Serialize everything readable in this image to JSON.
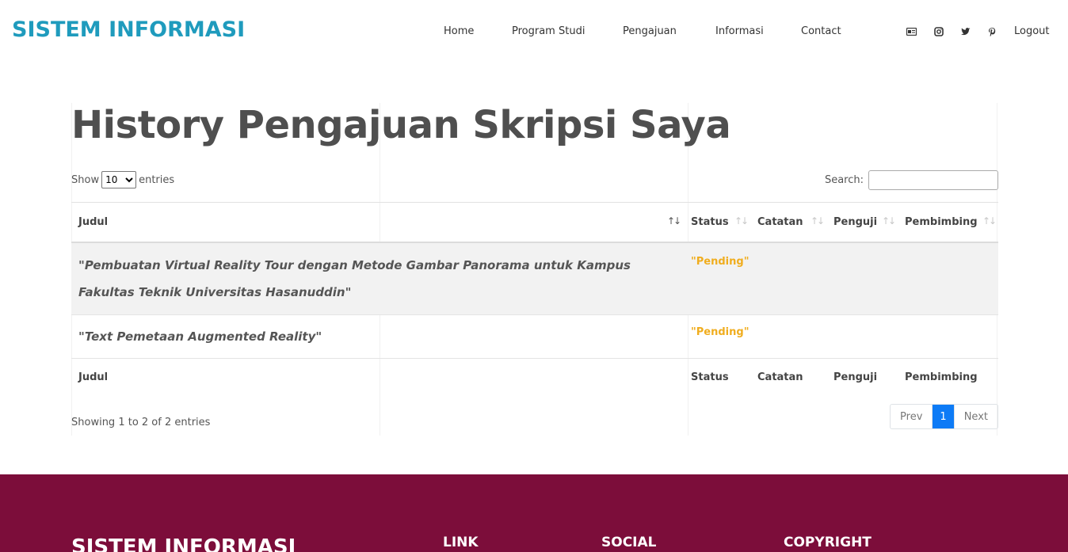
{
  "header": {
    "brand": "SISTEM INFORMASI",
    "nav": [
      "Home",
      "Program Studi",
      "Pengajuan",
      "Informasi",
      "Contact"
    ],
    "social_icons": [
      "id-card-icon",
      "instagram-icon",
      "twitter-icon",
      "pinterest-icon"
    ],
    "logout": "Logout"
  },
  "page": {
    "title": "History Pengajuan Skripsi Saya"
  },
  "table_controls": {
    "show_label": "Show",
    "entries_label": "entries",
    "page_length": "10",
    "search_label": "Search:",
    "search_value": ""
  },
  "table": {
    "columns": [
      "Judul",
      "Status",
      "Catatan",
      "Penguji",
      "Pembimbing"
    ],
    "rows": [
      {
        "judul": "\"Pembuatan Virtual Reality Tour dengan Metode Gambar Panorama untuk Kampus Fakultas Teknik Universitas Hasanuddin\"",
        "status": "\"Pending\"",
        "catatan": "",
        "penguji": "",
        "pembimbing": ""
      },
      {
        "judul": "\"Text Pemetaan Augmented Reality\"",
        "status": "\"Pending\"",
        "catatan": "",
        "penguji": "",
        "pembimbing": ""
      }
    ],
    "info": "Showing 1 to 2 of 2 entries",
    "pagination": {
      "prev": "Prev",
      "current": "1",
      "next": "Next"
    }
  },
  "footer": {
    "brand": "SISTEM INFORMASI",
    "headings": [
      "LINK",
      "SOCIAL",
      "COPYRIGHT"
    ]
  },
  "colors": {
    "brand": "#1f9bbd",
    "pending": "#f0ad1e",
    "footer_bg": "#7c0d3a",
    "pager_active": "#0d7bf6"
  }
}
